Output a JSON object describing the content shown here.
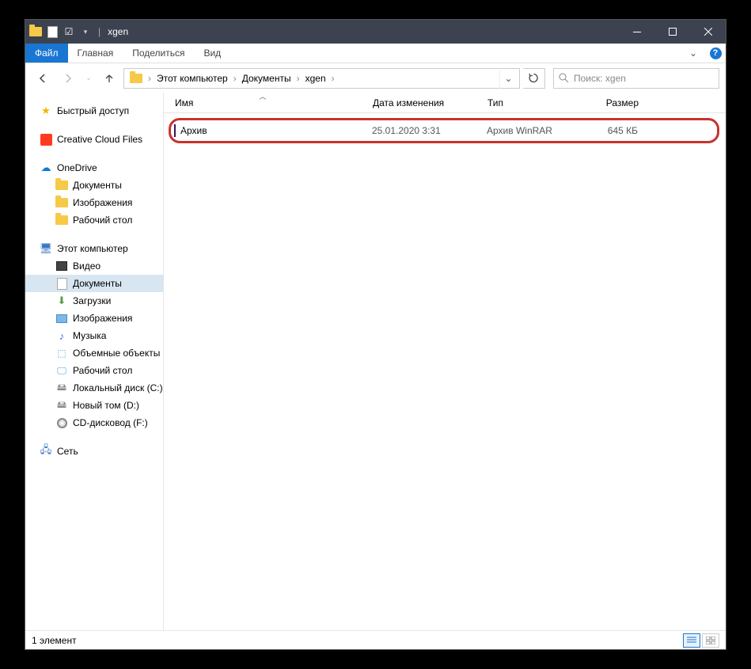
{
  "window": {
    "title": "xgen"
  },
  "ribbon": {
    "file": "Файл",
    "tabs": [
      "Главная",
      "Поделиться",
      "Вид"
    ]
  },
  "breadcrumbs": [
    "Этот компьютер",
    "Документы",
    "xgen"
  ],
  "search": {
    "placeholder": "Поиск: xgen"
  },
  "sidebar": {
    "quick": "Быстрый доступ",
    "cc": "Creative Cloud Files",
    "onedrive": "OneDrive",
    "onedrive_children": [
      "Документы",
      "Изображения",
      "Рабочий стол"
    ],
    "thispc": "Этот компьютер",
    "thispc_children": [
      {
        "label": "Видео",
        "icon": "video"
      },
      {
        "label": "Документы",
        "icon": "doc",
        "selected": true
      },
      {
        "label": "Загрузки",
        "icon": "down"
      },
      {
        "label": "Изображения",
        "icon": "pic"
      },
      {
        "label": "Музыка",
        "icon": "music"
      },
      {
        "label": "Объемные объекты",
        "icon": "3d"
      },
      {
        "label": "Рабочий стол",
        "icon": "desk"
      },
      {
        "label": "Локальный диск (C:)",
        "icon": "disk"
      },
      {
        "label": "Новый том (D:)",
        "icon": "disk"
      },
      {
        "label": "CD-дисковод (F:)",
        "icon": "cd"
      }
    ],
    "network": "Сеть"
  },
  "columns": {
    "name": "Имя",
    "date": "Дата изменения",
    "type": "Тип",
    "size": "Размер"
  },
  "files": [
    {
      "name": "Архив",
      "date": "25.01.2020 3:31",
      "type": "Архив WinRAR",
      "size": "645 КБ"
    }
  ],
  "status": {
    "count": "1 элемент"
  }
}
